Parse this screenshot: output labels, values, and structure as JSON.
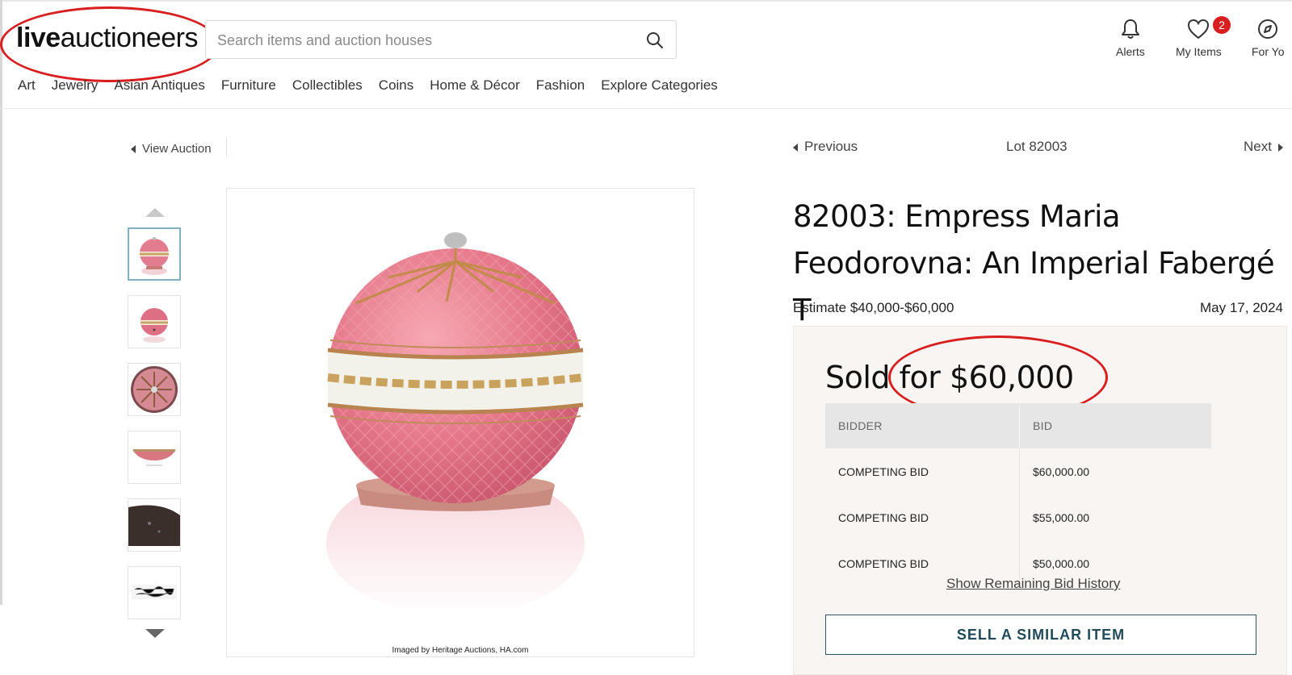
{
  "header": {
    "logo_bold": "live",
    "logo_regular": "auctioneers",
    "search_placeholder": "Search items and auction houses",
    "alerts_label": "Alerts",
    "my_items_label": "My Items",
    "my_items_count": "2",
    "for_you_label": "For Yo"
  },
  "nav": {
    "items": [
      "Art",
      "Jewelry",
      "Asian Antiques",
      "Furniture",
      "Collectibles",
      "Coins",
      "Home & Décor",
      "Fashion",
      "Explore Categories"
    ]
  },
  "breadcrumb": {
    "view_auction": "View Auction",
    "previous": "Previous",
    "lot_number": "Lot 82003",
    "next": "Next"
  },
  "lot": {
    "title": "82003: Empress Maria Feodorovna: An Imperial Fabergé T",
    "estimate": "Estimate $40,000-$60,000",
    "date": "May 17, 2024",
    "image_credit": "Imaged by Heritage Auctions, HA.com"
  },
  "bidding": {
    "sold_prefix": "Sold for",
    "sold_amount": "$60,000",
    "columns": [
      "BIDDER",
      "BID"
    ],
    "rows": [
      {
        "bidder": "COMPETING BID",
        "bid": "$60,000.00"
      },
      {
        "bidder": "COMPETING BID",
        "bid": "$55,000.00"
      },
      {
        "bidder": "COMPETING BID",
        "bid": "$50,000.00"
      }
    ],
    "show_remaining": "Show Remaining Bid History",
    "sell_similar": "SELL A SIMILAR ITEM"
  },
  "colors": {
    "annotation_red": "#d81e1e",
    "accent_teal": "#1f4b5a",
    "badge_red": "#d81e1e",
    "panel_bg": "#f8f5f2"
  }
}
